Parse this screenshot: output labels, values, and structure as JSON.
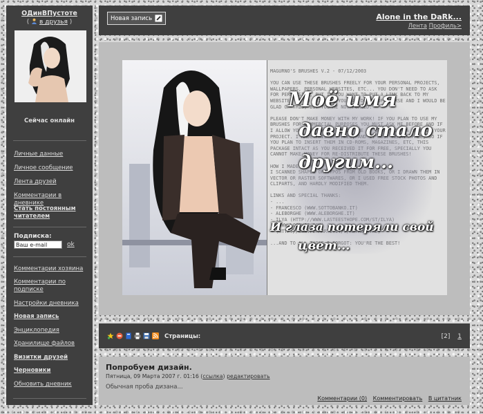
{
  "sidebar": {
    "user_name": "ОДинВПустоте",
    "friend_open": "(",
    "friend_link": "в друзья",
    "friend_close": ")",
    "online_status": "Сейчас онлайн",
    "links_top": [
      "Личные данные",
      "Личное сообщение",
      "Лента друзей",
      "Комментарии в дневнике"
    ],
    "become_reader": "Стать постоянным читателем",
    "subscribe_label": "Подписка:",
    "email_value": "Ваш e-mail",
    "ok_label": "ok",
    "links_bottom": [
      {
        "label": "Комментарии хозяина",
        "bold": false
      },
      {
        "label": "Комментарии по подписке",
        "bold": false
      },
      {
        "label": "Настройки дневника",
        "bold": false
      },
      {
        "label": "Новая запись",
        "bold": true
      },
      {
        "label": "Энциклопедия",
        "bold": false
      },
      {
        "label": "Хранилище файлов",
        "bold": false
      },
      {
        "label": "Визитки друзей",
        "bold": true
      },
      {
        "label": "Черновики",
        "bold": true
      },
      {
        "label": "Обновить дневник",
        "bold": false
      }
    ]
  },
  "header": {
    "new_post_label": "Новая запись",
    "blog_title": "Alone in the DaRk...",
    "feed_link": "Лента",
    "profile_link": "Профиль>"
  },
  "banner": {
    "brush_text": "MAGURNO'S BRUSHES V.2 - 07/12/2003\n\nYOU CAN USE THESE BRUSHES FREELY FOR YOUR PERSONAL PROJECTS, WALLPAPERS, PERSONAL WEBSITES, ETC... YOU DON'T NEED TO ASK FOR PERMISSION, BUT IF YOU WANT TO PUT A LINK BACK TO MY WEBSITE, OR TO WRITE ME YOU CAN DO IT OF COURSE AND I WOULD BE GLAD OF THIS, BUT YOU'RE NOT FORCED.\n\nPLEASE DON'T MAKE MONEY WITH MY WORK! IF YOU PLAN TO USE MY BRUSHES FOR COMMERCIAL PURPOSES YOU MUST ASK ME BEFORE AND IF I ALLOW YOU, YOU SHOULD CREDIT ME AT LEAST WITH A NOTE ON YOUR PROJECT. I MADE THIS SET FREE, AND IT MUST REMAIN FREE, SO IF YOU PLAN TO INSERT THEM IN CD-ROMS, MAGAZINES, ETC, THIS PACKAGE INTACT AS YOU RECEIVED IT FOR FREE, SPECIALLY YOU CANNOT MAKE MONEY FOR RE-DISTRIBUTE THESE BRUSHES!\n\nHOW I MADE THEM?\nI SCANNED SHAPES OR TYPOS FROM OLD BOOKS, OR I DRAWN THEM IN VECTOR OR RASTER SOFTWARES, OR I USED FREE STOCK PHOTOS AND CLIPARTS, AND HARDLY MODIFIED THEM.\n\nLINKS AND SPECIAL THANKS:\n- ...\n- FRANCESCO (WWW.SOTTOBANKO.IT)\n- ALEBORGHE (WWW.ALEBORGHE.IT)\n- ILYA (HTTP://WWW.LASTEESTHOPE.COM/ST/ILYA)\n- (WWW.LOOPKIT.COM)\n- (HTTP://WWW.PERMARTE.IT/0/METRO.HTML)\n\n...AND TO ALL THOSE I FORGOT: YOU'RE THE BEST!",
    "poem_line1": "Моё имя",
    "poem_line2": "давно стало",
    "poem_line3": "другим...",
    "poem_line4": "И глаза потеряли свой",
    "poem_line5": "цвет..."
  },
  "toolbar": {
    "icons": [
      "star-icon",
      "minus-circle-icon",
      "bookmark-icon",
      "print-icon",
      "save-icon",
      "rss-icon"
    ],
    "pages_label": "Страницы:",
    "pages": [
      "[2]",
      "1"
    ]
  },
  "post": {
    "title": "Попробуем дизайн.",
    "date": "Пятница, 09 Марта 2007 г. 01:16",
    "link_open": "(",
    "link_label": "ссылка",
    "link_close": ")",
    "edit_label": "редактировать",
    "body": "Обычная проба дизана...",
    "comments_label": "Комментарии (0)",
    "comment_label": "Комментировать",
    "quote_label": "В цитатник"
  }
}
